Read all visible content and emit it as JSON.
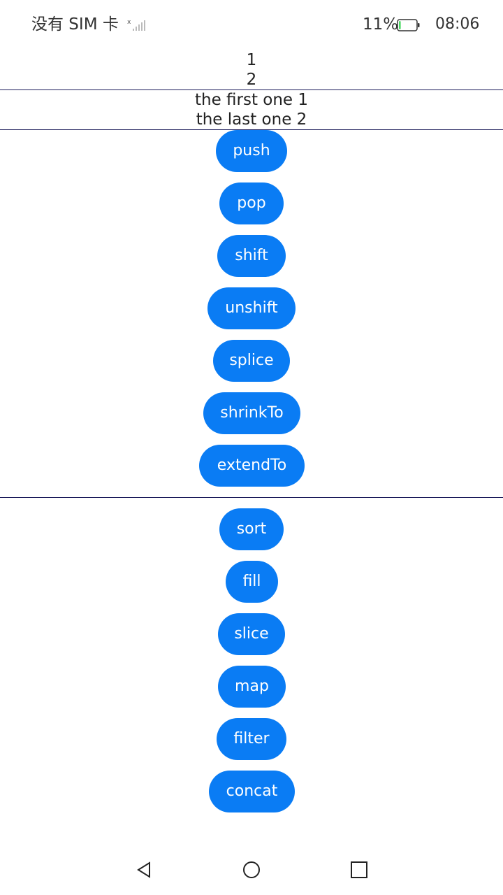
{
  "status_bar": {
    "carrier": "没有 SIM 卡",
    "battery_percent": "11%",
    "time": "08:06",
    "signal_icon": "signal-icon",
    "battery_icon": "battery-icon",
    "battery_level": 0.11
  },
  "array_view": {
    "items": [
      "1",
      "2"
    ],
    "first_label": "the first one 1",
    "last_label": "the last one 2"
  },
  "mutation_buttons": [
    "push",
    "pop",
    "shift",
    "unshift",
    "splice",
    "shrinkTo",
    "extendTo"
  ],
  "transform_buttons": [
    "sort",
    "fill",
    "slice",
    "map",
    "filter",
    "concat"
  ],
  "nav_bar": {
    "back_icon": "back-triangle-icon",
    "home_icon": "home-circle-icon",
    "recents_icon": "recents-square-icon"
  },
  "colors": {
    "button_bg": "#0a7cf4",
    "button_text": "#ffffff",
    "divider": "#1b1b5a",
    "battery_fill": "#4cd964"
  }
}
